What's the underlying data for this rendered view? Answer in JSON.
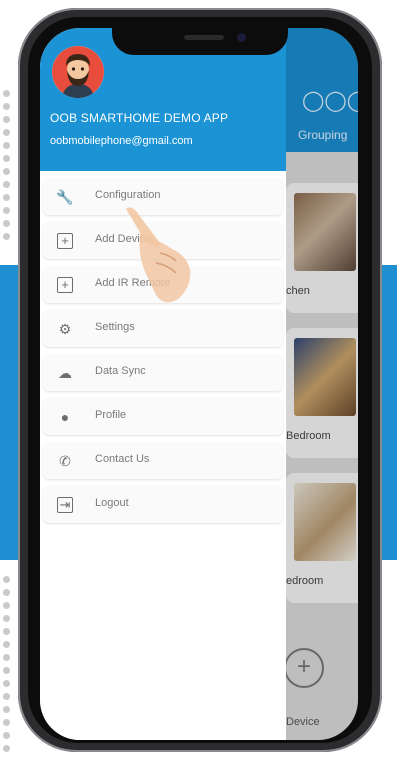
{
  "colors": {
    "accent": "#1b93d4",
    "band": "#1e8fd0"
  },
  "drawer": {
    "app_name": "OOB SMARTHOME DEMO APP",
    "email": "oobmobilephone@gmail.com",
    "items": [
      {
        "label": "Configuration",
        "icon": "wrench-icon"
      },
      {
        "label": "Add Device",
        "icon": "plus-box-icon"
      },
      {
        "label": "Add IR Remote",
        "icon": "plus-box-icon"
      },
      {
        "label": "Settings",
        "icon": "gear-icon"
      },
      {
        "label": "Data Sync",
        "icon": "cloud-upload-icon"
      },
      {
        "label": "Profile",
        "icon": "person-icon"
      },
      {
        "label": "Contact Us",
        "icon": "phone-icon"
      },
      {
        "label": "Logout",
        "icon": "logout-icon"
      }
    ]
  },
  "background": {
    "grouping_label": "Grouping",
    "rooms": [
      "chen",
      "Bedroom",
      "edroom"
    ],
    "add_device_label": "Device"
  }
}
